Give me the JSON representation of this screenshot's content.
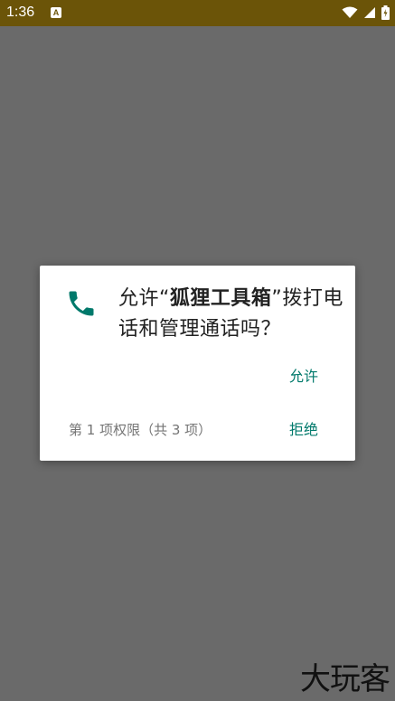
{
  "status_bar": {
    "time": "1:36",
    "app_icon_label": "A",
    "icons": [
      "wifi-icon",
      "cell-signal-icon",
      "battery-icon"
    ],
    "background": "#6b5408"
  },
  "dialog": {
    "icon": "phone-icon",
    "message_prefix": "允许“",
    "app_name": "狐狸工具箱",
    "message_suffix": "”拨打电话和管理通话吗？",
    "allow_label": "允许",
    "permission_counter": "第 1 项权限（共 3 项）",
    "deny_label": "拒绝",
    "accent_color": "#00796b"
  },
  "watermark": {
    "text": "大玩客"
  }
}
